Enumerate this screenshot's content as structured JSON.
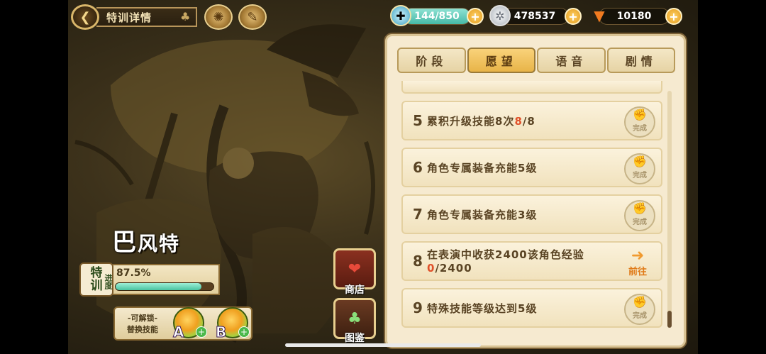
{
  "header": {
    "title": "特训详情"
  },
  "resources": [
    {
      "value": "144/850",
      "icon": "potion-icon"
    },
    {
      "value": "478537",
      "icon": "coin-icon"
    },
    {
      "value": "10180",
      "icon": "carrot-icon"
    }
  ],
  "character": {
    "name_first": "巴",
    "name_rest": "风特"
  },
  "training": {
    "tag_line1": "特",
    "tag_line2": "训",
    "tag_sub": "进度",
    "progress_text": "87.5%",
    "progress_fraction": 0.875
  },
  "skills": {
    "label1": "-可解锁-",
    "label2": "替换技能",
    "slot_a": "A",
    "slot_b": "B"
  },
  "side_buttons": {
    "shop": "商店",
    "gallery": "图鉴"
  },
  "tabs": [
    {
      "label": "阶段",
      "active": false
    },
    {
      "label": "愿望",
      "active": true
    },
    {
      "label": "语音",
      "active": false
    },
    {
      "label": "剧情",
      "active": false
    }
  ],
  "tasks": [
    {
      "num": "5",
      "text_before": "累积升级技能8次",
      "highlight": "8",
      "text_after": "/8",
      "status": "完成"
    },
    {
      "num": "6",
      "text": "角色专属装备充能5级",
      "status": "完成"
    },
    {
      "num": "7",
      "text": "角色专属装备充能3级",
      "status": "完成"
    },
    {
      "num": "8",
      "text_line1": "在表演中收获2400该角色经验",
      "highlight": "0",
      "text_line2_after": "/2400",
      "action": "前往"
    },
    {
      "num": "9",
      "text": "特殊技能等级达到5级",
      "status": "完成"
    }
  ],
  "colors": {
    "panel_bg": "#f6ead0",
    "tab_active": "#f0c25e",
    "highlight": "#e0512a",
    "progress_fill": "#49c3a0"
  }
}
